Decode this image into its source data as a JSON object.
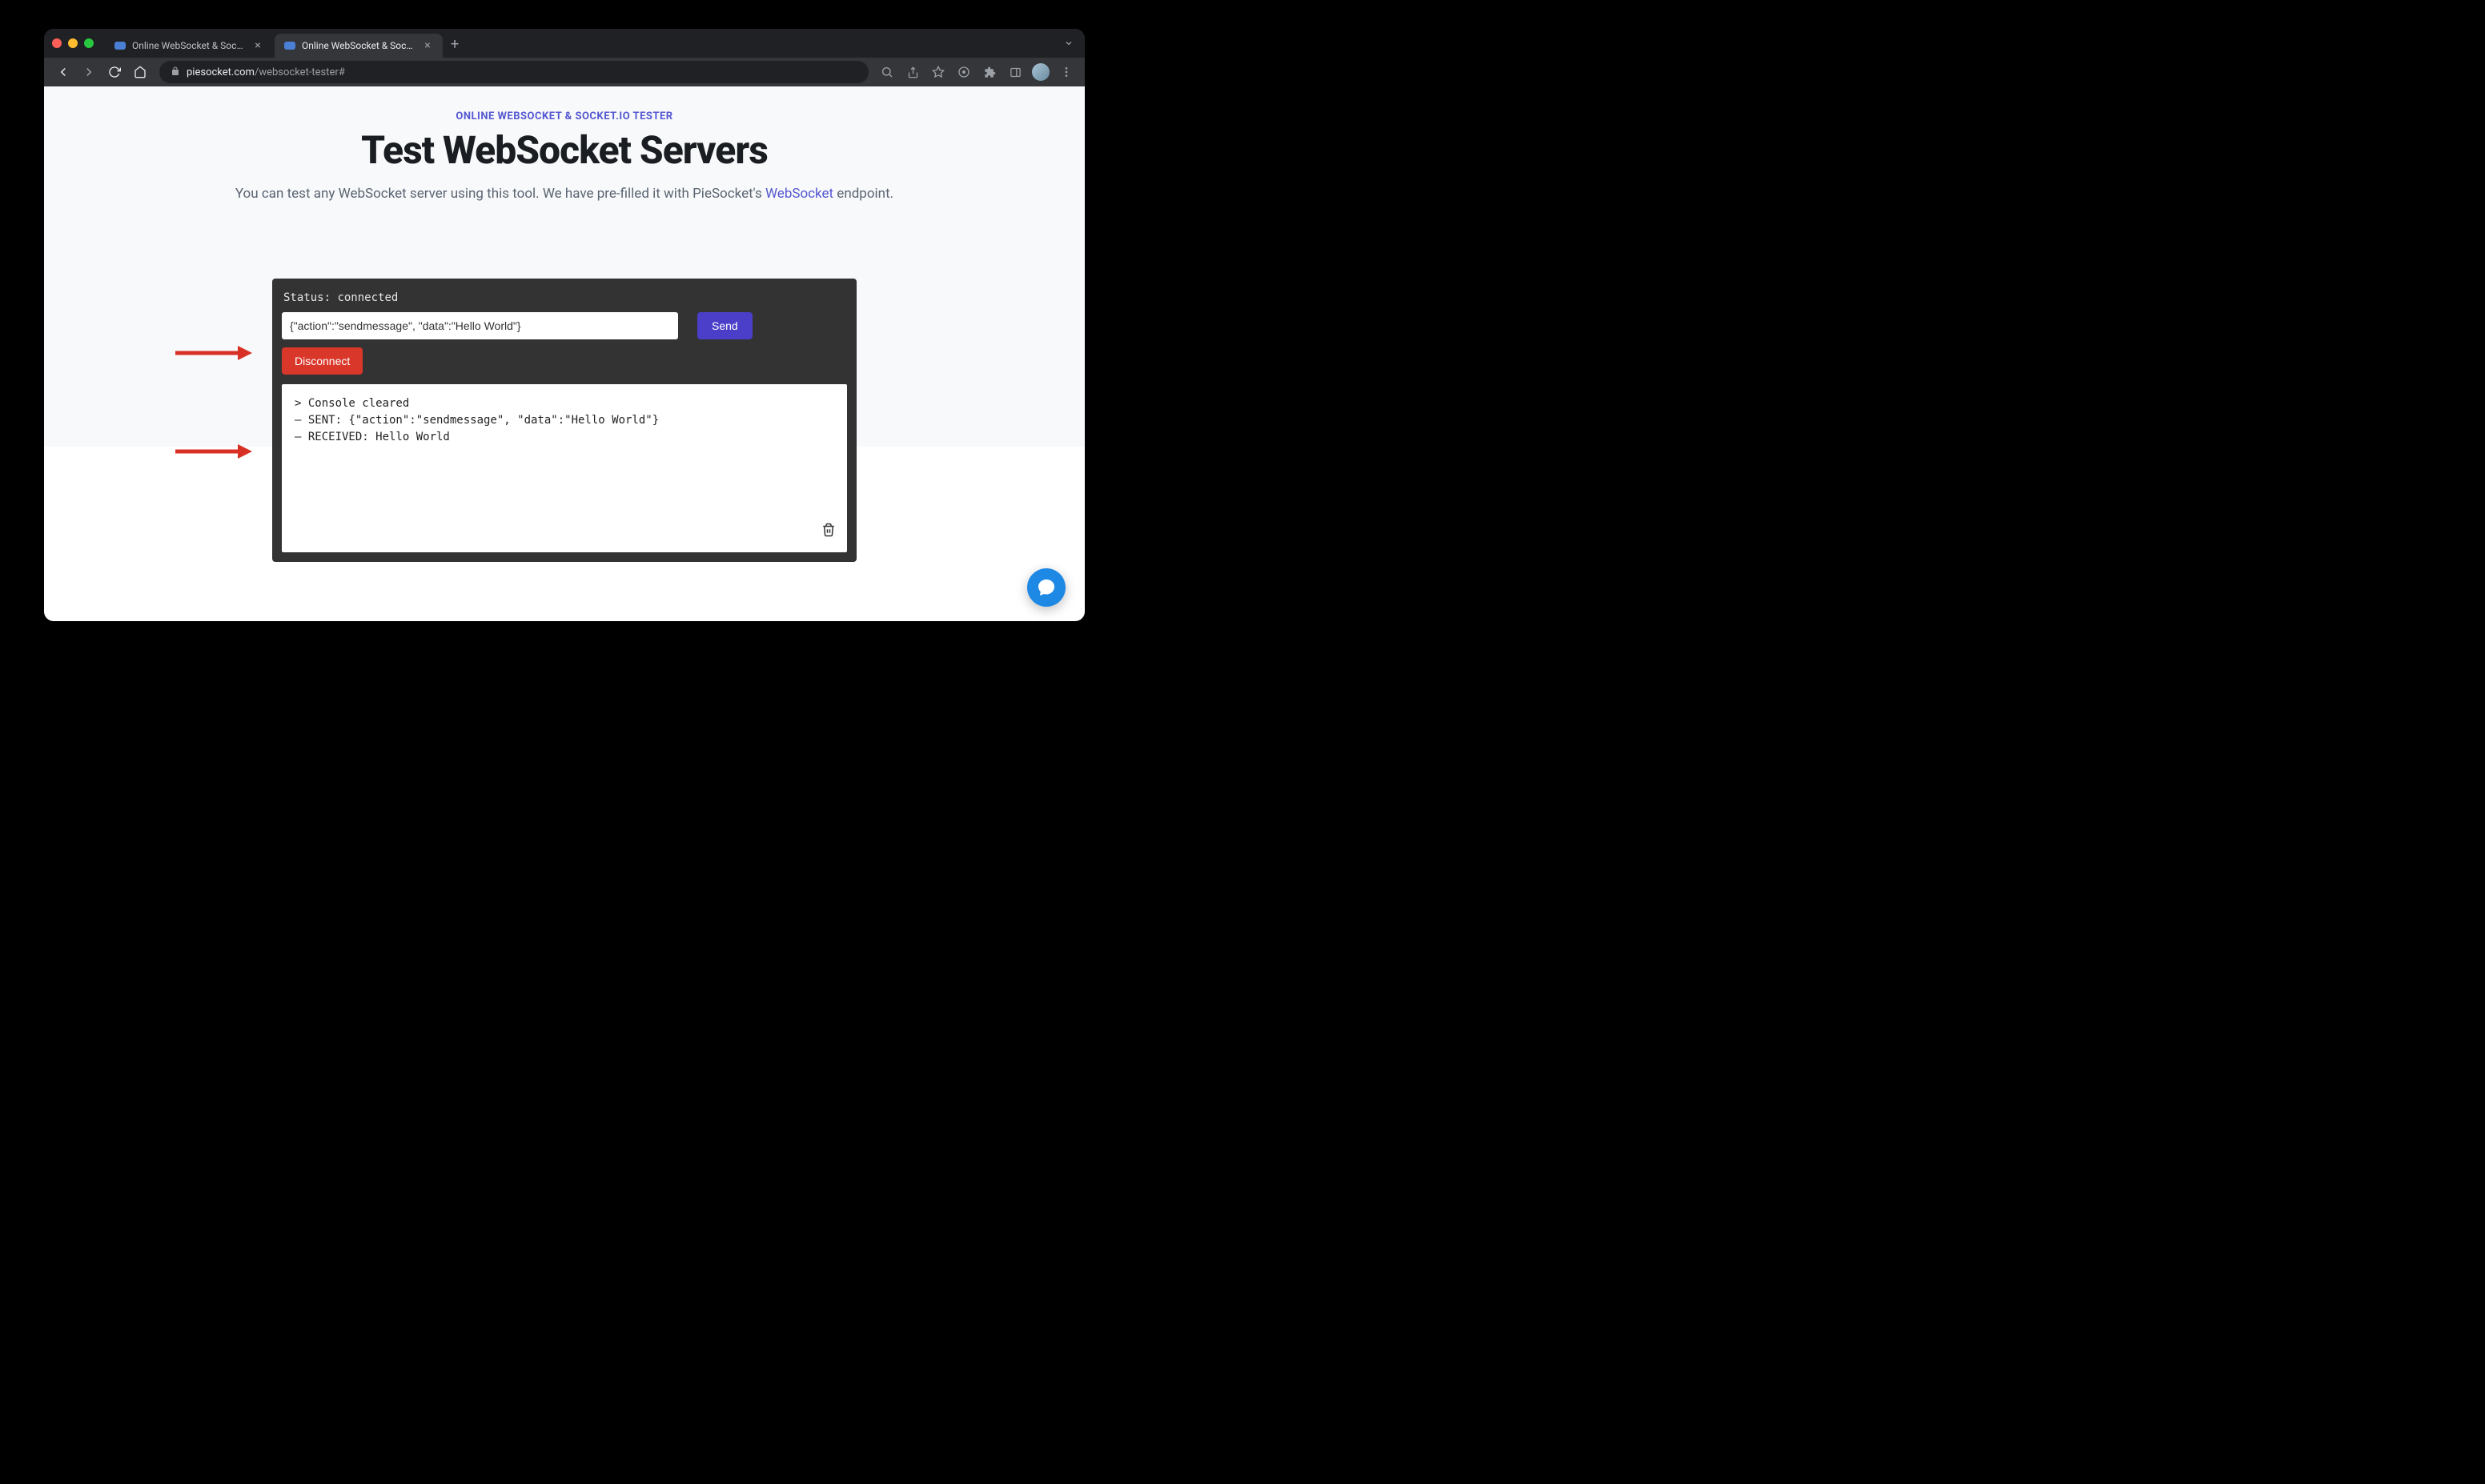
{
  "browser": {
    "tabs": [
      {
        "title": "Online WebSocket & Socket.io",
        "active": false
      },
      {
        "title": "Online WebSocket & Socket.io",
        "active": true
      }
    ],
    "url_domain": "piesocket.com",
    "url_path": "/websocket-tester#"
  },
  "page": {
    "eyebrow": "ONLINE WEBSOCKET & SOCKET.IO TESTER",
    "headline": "Test WebSocket Servers",
    "subhead_before": "You can test any WebSocket server using this tool. We have pre-filled it with PieSocket's ",
    "subhead_link": "WebSocket",
    "subhead_after": " endpoint."
  },
  "tester": {
    "status_label": "Status:",
    "status_value": "connected",
    "message_value": "{\"action\":\"sendmessage\", \"data\":\"Hello World\"}",
    "send_label": "Send",
    "disconnect_label": "Disconnect",
    "console_lines": [
      "> Console cleared",
      "– SENT: {\"action\":\"sendmessage\", \"data\":\"Hello World\"}",
      "– RECEIVED: Hello World"
    ]
  }
}
